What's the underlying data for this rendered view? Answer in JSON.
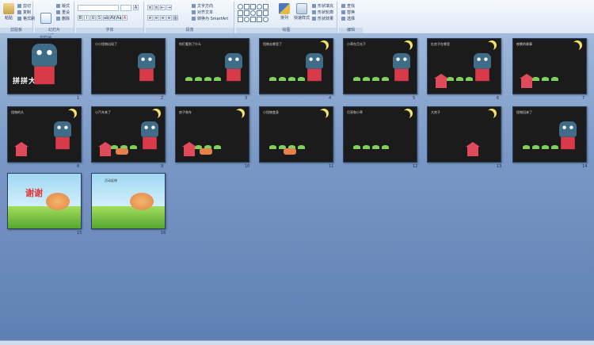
{
  "ribbon": {
    "groups": [
      {
        "label": "剪贴板",
        "big_button": "粘贴",
        "small_buttons": [
          "剪切",
          "复制",
          "格式刷"
        ]
      },
      {
        "label": "幻灯片",
        "big_button": "新建\n幻灯片",
        "small_buttons": [
          "版式",
          "重设",
          "删除"
        ]
      },
      {
        "label": "字体",
        "font_name": "",
        "font_size": "",
        "tools": [
          "B",
          "I",
          "U",
          "S",
          "ab",
          "AV",
          "Aa",
          "A"
        ]
      },
      {
        "label": "段落",
        "small_buttons": [
          "文字方向",
          "对齐文本",
          "转换为 SmartArt"
        ]
      },
      {
        "label": "绘图",
        "big_buttons": [
          "排列",
          "快速样式"
        ],
        "small_buttons": [
          "形状填充",
          "形状轮廓",
          "形状效果"
        ]
      },
      {
        "label": "编辑",
        "small_buttons": [
          "查找",
          "替换",
          "选择"
        ]
      }
    ]
  },
  "slides": [
    {
      "number": "1",
      "title_text": "拼拼大怪物"
    },
    {
      "number": "2",
      "text": "小小怪物出现了"
    },
    {
      "number": "3",
      "text": "你们看到了什么"
    },
    {
      "number": "4",
      "text": "怪物去哪里了"
    },
    {
      "number": "5",
      "text": "小草在月光下"
    },
    {
      "number": "6",
      "text": "红房子在哪里"
    },
    {
      "number": "7",
      "text": "夜晚的故事"
    },
    {
      "number": "8",
      "text": "怪物的头"
    },
    {
      "number": "9",
      "text": "小汽车来了"
    },
    {
      "number": "10",
      "text": "房子和车"
    },
    {
      "number": "11",
      "text": "小怪物变身"
    },
    {
      "number": "12",
      "text": "月亮和小草"
    },
    {
      "number": "13",
      "text": "大房子"
    },
    {
      "number": "14",
      "text": "怪物回来了"
    },
    {
      "number": "15",
      "title_text": "谢谢"
    },
    {
      "number": "16",
      "text": "活动延伸"
    }
  ],
  "colors": {
    "background_top": "#c8d9ee",
    "background_bottom": "#5f7fb3",
    "slide_dark": "#1b1b1b",
    "monster_body": "#d83a4a",
    "monster_head": "#3f6d88",
    "moon": "#f2e36a",
    "grass": "#7ed25a"
  },
  "icons": [
    "paste-icon",
    "cut-icon",
    "copy-icon",
    "format-painter-icon",
    "new-slide-icon",
    "arrange-icon",
    "quick-styles-icon",
    "find-icon",
    "replace-icon",
    "select-icon"
  ]
}
